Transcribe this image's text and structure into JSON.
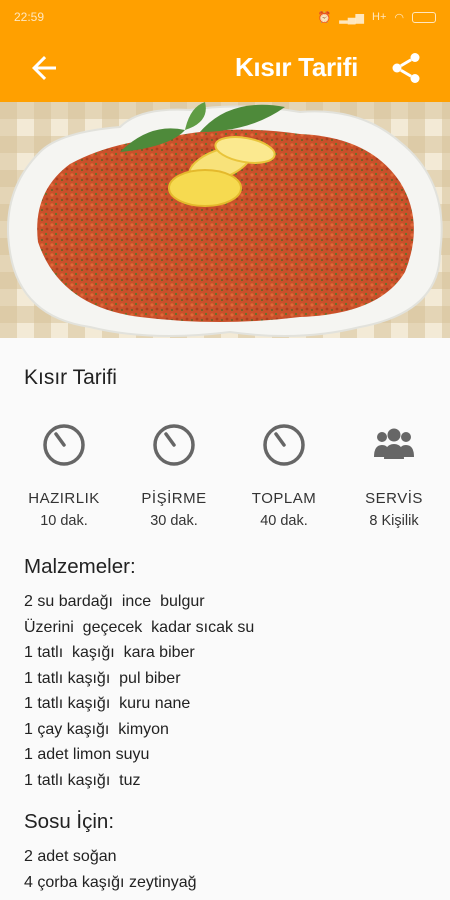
{
  "status_bar": {
    "time": "22:59",
    "network": "H+"
  },
  "app_bar": {
    "title": "Kısır Tarifi",
    "back_icon": "back-arrow-icon",
    "share_icon": "share-icon"
  },
  "colors": {
    "accent": "#ffa000"
  },
  "recipe": {
    "title": "Kısır Tarifi",
    "stats": [
      {
        "label": "HAZIRLIK",
        "value": "10 dak.",
        "icon": "timer-icon"
      },
      {
        "label": "PİŞİRME",
        "value": "30 dak.",
        "icon": "timer-icon"
      },
      {
        "label": "TOPLAM",
        "value": "40 dak.",
        "icon": "timer-icon"
      },
      {
        "label": "SERVİS",
        "value": "8 Kişilik",
        "icon": "group-icon"
      }
    ],
    "ingredients_title": "Malzemeler:",
    "ingredients": [
      "2 su bardağı  ince  bulgur",
      "Üzerini  geçecek  kadar sıcak su",
      "1 tatlı  kaşığı  kara biber",
      "1 tatlı kaşığı  pul biber",
      "1 tatlı kaşığı  kuru nane",
      "1 çay kaşığı  kimyon",
      "1 adet limon suyu",
      "1 tatlı kaşığı  tuz"
    ],
    "sauce_title": "Sosu İçin:",
    "sauce": [
      "2 adet soğan",
      "4 çorba kaşığı zeytinyağ"
    ]
  }
}
